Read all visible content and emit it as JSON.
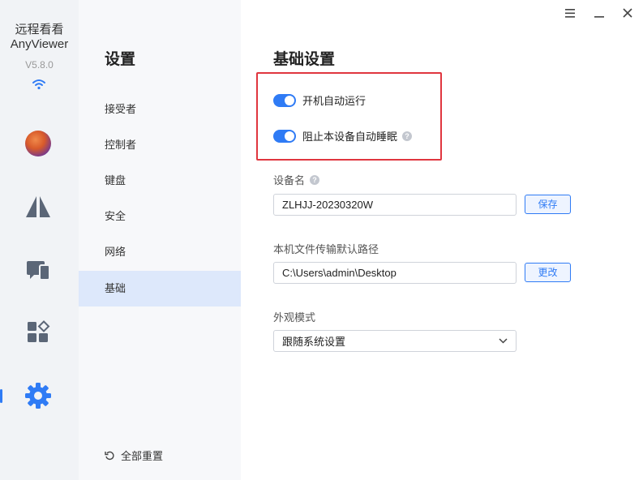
{
  "app": {
    "name_line1": "远程看看",
    "name_line2": "AnyViewer",
    "version": "V5.8.0"
  },
  "rail": {
    "items": [
      {
        "icon": "avatar"
      },
      {
        "icon": "connect-icon"
      },
      {
        "icon": "devices-icon"
      },
      {
        "icon": "apps-icon"
      },
      {
        "icon": "gear-icon",
        "active": true
      }
    ]
  },
  "settings_nav": {
    "title": "设置",
    "items": [
      {
        "label": "接受者"
      },
      {
        "label": "控制者"
      },
      {
        "label": "键盘"
      },
      {
        "label": "安全"
      },
      {
        "label": "网络"
      },
      {
        "label": "基础",
        "active": true
      }
    ],
    "reset_label": "全部重置"
  },
  "main": {
    "title": "基础设置",
    "toggles": [
      {
        "label": "开机自动运行",
        "on": true
      },
      {
        "label": "阻止本设备自动睡眠",
        "on": true,
        "help": "?"
      }
    ],
    "device_name": {
      "label": "设备名",
      "help": "?",
      "value": "ZLHJJ-20230320W",
      "button": "保存"
    },
    "transfer_path": {
      "label": "本机文件传输默认路径",
      "value": "C:\\Users\\admin\\Desktop",
      "button": "更改"
    },
    "appearance": {
      "label": "外观模式",
      "selected": "跟随系统设置"
    }
  },
  "colors": {
    "accent": "#2f7bf5",
    "highlight_border": "#e0363f",
    "rail_bg": "#f1f3f6",
    "nav_active_bg": "#dde8fb"
  }
}
